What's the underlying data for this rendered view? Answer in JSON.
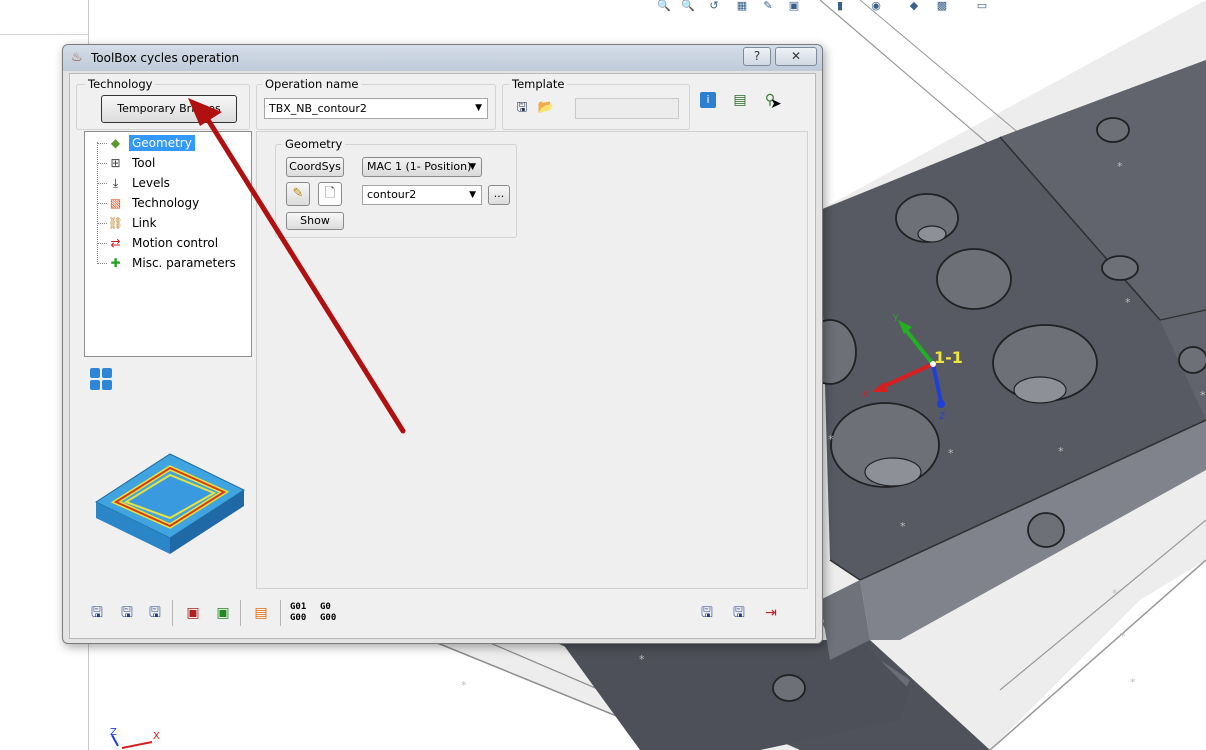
{
  "window": {
    "title": "ToolBox cycles operation",
    "help_label": "?",
    "close_label": "✕"
  },
  "technology": {
    "group_label": "Technology",
    "button_label": "Temporary Bridges"
  },
  "operation": {
    "group_label": "Operation name",
    "value": "TBX_NB_contour2"
  },
  "template": {
    "group_label": "Template",
    "value": ""
  },
  "tree": {
    "items": [
      {
        "label": "Geometry",
        "icon": "geometry-icon",
        "selected": true
      },
      {
        "label": "Tool",
        "icon": "tool-icon",
        "selected": false
      },
      {
        "label": "Levels",
        "icon": "levels-icon",
        "selected": false
      },
      {
        "label": "Technology",
        "icon": "technology-icon",
        "selected": false
      },
      {
        "label": "Link",
        "icon": "link-icon",
        "selected": false
      },
      {
        "label": "Motion control",
        "icon": "motion-control-icon",
        "selected": false
      },
      {
        "label": "Misc. parameters",
        "icon": "misc-parameters-icon",
        "selected": false
      }
    ]
  },
  "geometry": {
    "group_label": "Geometry",
    "coordsys_label": "CoordSys",
    "coordsys_value": "MAC 1 (1- Position)",
    "contour_value": "contour2",
    "browse_label": "...",
    "show_label": "Show"
  },
  "bottom_toolbar": {
    "gcode_top_left": "G01",
    "gcode_bottom_left": "G00",
    "gcode_top_right": "G0",
    "gcode_bottom_right": "G00"
  },
  "viewport": {
    "coord_label": "1-1",
    "axis_x": "X",
    "axis_y": "Y",
    "axis_z": "Z",
    "triad_x": "X",
    "triad_z": "Z"
  },
  "colors": {
    "accent": "#3399ff",
    "arrow": "#b01010",
    "part_top": "#5b5e66",
    "part_side": "#7c7f87",
    "bg_plate": "#e6e6e6"
  }
}
